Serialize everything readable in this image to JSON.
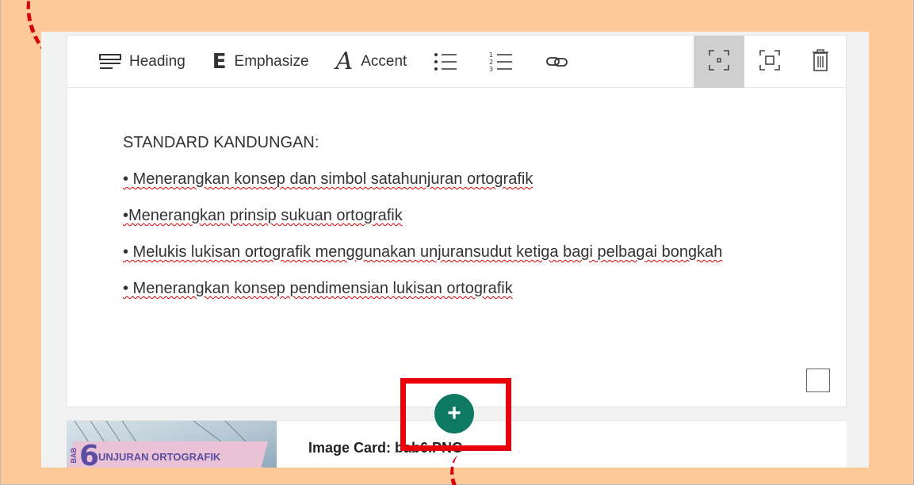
{
  "toolbar": {
    "heading_label": "Heading",
    "emphasize_label": "Emphasize",
    "accent_label": "Accent",
    "emphasize_glyph": "E",
    "accent_glyph": "A",
    "icons": [
      "heading-icon",
      "emphasize-icon",
      "accent-icon",
      "bulleted-list-icon",
      "numbered-list-icon",
      "link-icon",
      "fit-focus-icon",
      "fit-fill-icon",
      "trash-icon"
    ]
  },
  "editor": {
    "heading": "STANDARD KANDUNGAN:",
    "items": [
      "• Menerangkan konsep dan simbol satahunjuran ortografik",
      "•Menerangkan prinsip sukuan ortografik",
      "• Melukis lukisan ortografik menggunakan unjuransudut ketiga bagi pelbagai bongkah",
      "• Menerangkan konsep pendimensian lukisan ortografik"
    ]
  },
  "add_button": {
    "label": "+"
  },
  "card": {
    "title": "Image Card: bab6.PNG",
    "thumbnail": {
      "chapter_word": "BAB",
      "chapter_number": "6",
      "chapter_title": "UNJURAN ORTOGRAFIK"
    }
  },
  "colors": {
    "background": "#fdc999",
    "accent_green": "#0f7a63",
    "highlight_red": "#e8000b"
  }
}
